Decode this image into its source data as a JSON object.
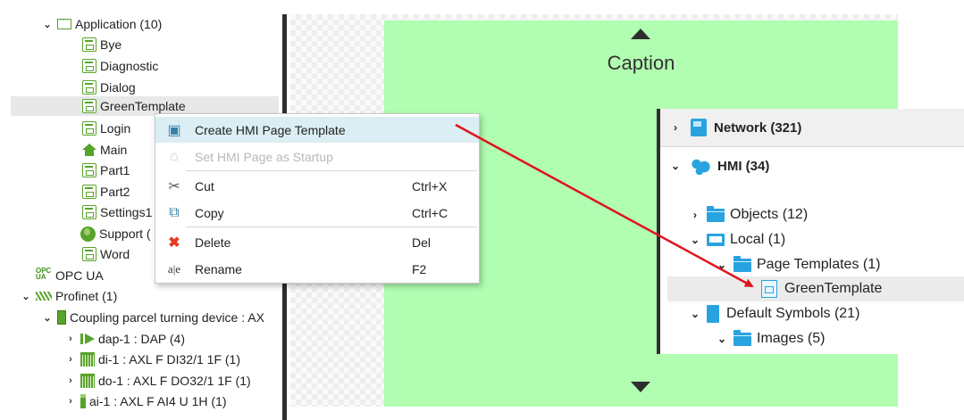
{
  "left_tree": {
    "application": {
      "label": "Application (10)"
    },
    "pages": [
      {
        "label": "Bye",
        "icon": "hmi-page-icon"
      },
      {
        "label": "Diagnostic",
        "icon": "hmi-page-icon"
      },
      {
        "label": "Dialog",
        "icon": "hmi-page-icon"
      },
      {
        "label": "GreenTemplate",
        "icon": "hmi-page-icon",
        "selected": true
      },
      {
        "label": "Login",
        "icon": "hmi-page-icon"
      },
      {
        "label": "Main",
        "icon": "home-icon"
      },
      {
        "label": "Part1",
        "icon": "hmi-page-icon"
      },
      {
        "label": "Part2",
        "icon": "hmi-page-icon"
      },
      {
        "label": "Settings1",
        "icon": "hmi-page-icon"
      },
      {
        "label": "Support (",
        "icon": "globe-icon"
      },
      {
        "label": "Word",
        "icon": "hmi-page-icon"
      }
    ],
    "opc_ua": {
      "label": "OPC UA",
      "icon_text": [
        "OPC",
        "UA"
      ]
    },
    "profinet": {
      "label": "Profinet (1)"
    },
    "coupler": {
      "label": "Coupling parcel turning device : AX"
    },
    "devices": [
      {
        "label": "dap-1 : DAP (4)",
        "icon": "dap-icon"
      },
      {
        "label": "di-1 : AXL F DI32/1 1F (1)",
        "icon": "io-module-icon"
      },
      {
        "label": "do-1 : AXL F DO32/1 1F (1)",
        "icon": "io-module-icon"
      },
      {
        "label": "ai-1 : AXL F AI4 U 1H (1)",
        "icon": "analog-module-icon"
      }
    ]
  },
  "context_menu": {
    "items": [
      {
        "label": "Create HMI Page Template",
        "shortcut": "",
        "icon": "create-template-icon",
        "glyph": "▣",
        "highlighted": true,
        "disabled": false
      },
      {
        "label": "Set HMI Page as Startup",
        "shortcut": "",
        "icon": "home-icon",
        "glyph": "⌂",
        "highlighted": false,
        "disabled": true
      },
      {
        "label": "Cut",
        "shortcut": "Ctrl+X",
        "icon": "scissors-icon",
        "glyph": "✂",
        "highlighted": false,
        "disabled": false
      },
      {
        "label": "Copy",
        "shortcut": "Ctrl+C",
        "icon": "copy-icon",
        "glyph": "⧉",
        "highlighted": false,
        "disabled": false
      },
      {
        "label": "Delete",
        "shortcut": "Del",
        "icon": "delete-icon",
        "glyph": "✖",
        "highlighted": false,
        "disabled": false
      },
      {
        "label": "Rename",
        "shortcut": "F2",
        "icon": "rename-icon",
        "glyph": "a|e",
        "highlighted": false,
        "disabled": false
      }
    ]
  },
  "canvas": {
    "caption": "Caption",
    "page_color": "#b1fdb1"
  },
  "right_panel": {
    "network": "Network (321)",
    "hmi": "HMI (34)",
    "objects": "Objects (12)",
    "local": "Local (1)",
    "page_templates": "Page Templates (1)",
    "green_template": "GreenTemplate",
    "default_symbols": "Default Symbols (21)",
    "images": "Images (5)"
  },
  "colors": {
    "accent_green": "#58a32b",
    "accent_blue": "#29a3e0",
    "highlight": "#daeef3",
    "arrow": "#e0141e",
    "delete_red": "#e53c23"
  }
}
